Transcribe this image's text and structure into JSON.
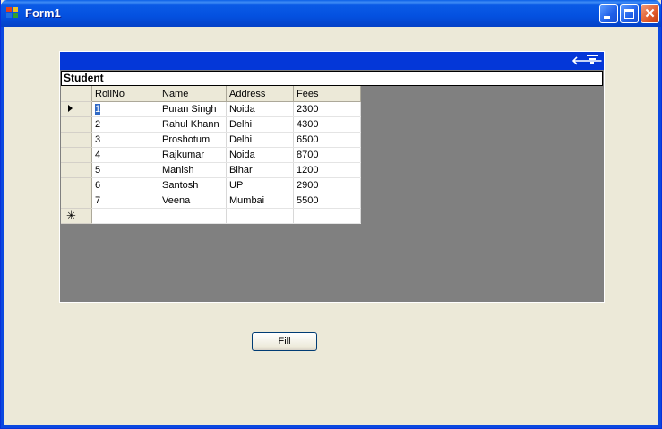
{
  "window": {
    "title": "Form1",
    "icons": {
      "app": "form-app-icon",
      "minimize": "minimize-icon",
      "maximize": "maximize-icon",
      "close": "close-icon"
    }
  },
  "grid": {
    "caption_icons": {
      "back": "back-arrow-icon",
      "hide": "hide-parent-rows-icon"
    },
    "parent_label": "Student",
    "columns": [
      "RollNo",
      "Name",
      "Address",
      "Fees"
    ],
    "rows": [
      [
        "1",
        "Puran Singh",
        "Noida",
        "2300"
      ],
      [
        "2",
        "Rahul Khann",
        "Delhi",
        "4300"
      ],
      [
        "3",
        "Proshotum",
        "Delhi",
        "6500"
      ],
      [
        "4",
        "Rajkumar",
        "Noida",
        "8700"
      ],
      [
        "5",
        "Manish",
        "Bihar",
        "1200"
      ],
      [
        "6",
        "Santosh",
        "UP",
        "2900"
      ],
      [
        "7",
        "Veena",
        "Mumbai",
        "5500"
      ]
    ],
    "new_row_marker": "✳"
  },
  "fill_button": {
    "label": "Fill"
  },
  "colors": {
    "titlebar": "#0451e0",
    "grid_background": "#808080",
    "caption": "#0437d8",
    "selection": "#316ac5",
    "form": "#ece9d8"
  }
}
